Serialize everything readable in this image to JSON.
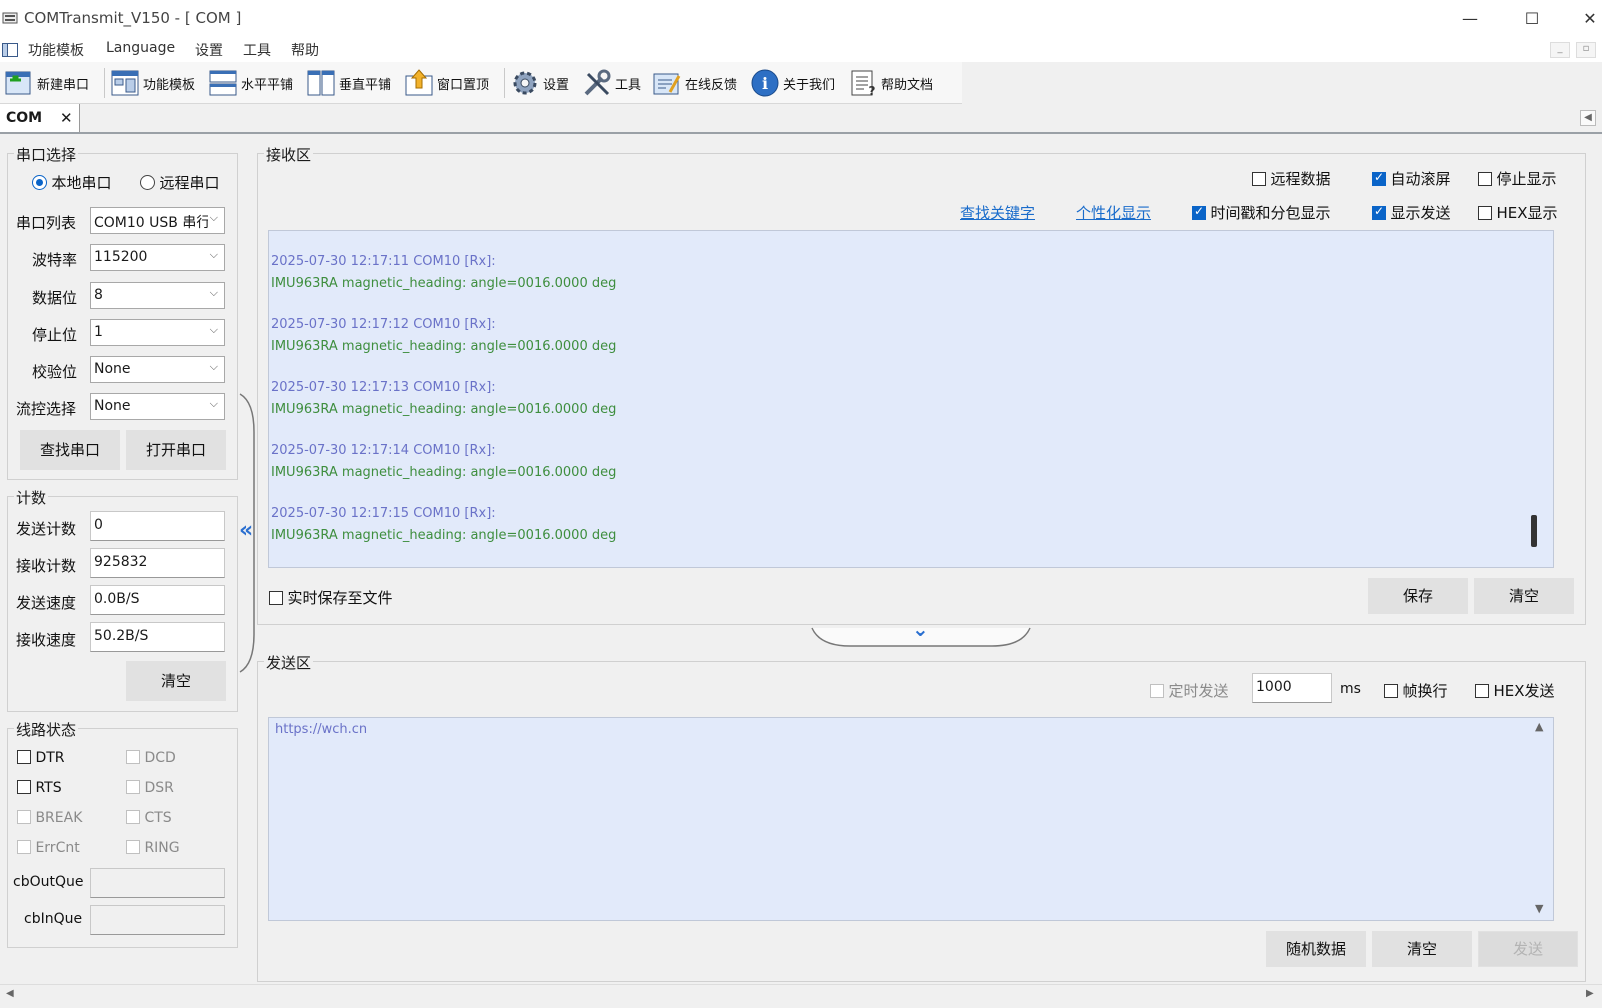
{
  "window": {
    "title": "COMTransmit_V150 - [  COM  ]"
  },
  "menu": [
    "功能模板",
    "Language",
    "设置",
    "工具",
    "帮助"
  ],
  "toolbar": [
    "新建串口",
    "功能模板",
    "水平平铺",
    "垂直平铺",
    "窗口置顶",
    "设置",
    "工具",
    "在线反馈",
    "关于我们",
    "帮助文档"
  ],
  "tab": {
    "label": "COM",
    "close": "✕"
  },
  "serial": {
    "title": "串口选择",
    "local_label": "本地串口",
    "remote_label": "远程串口",
    "port_label": "串口列表",
    "port_value": "COM10  USB 串行",
    "baud_label": "波特率",
    "baud_value": "115200",
    "data_label": "数据位",
    "data_value": "8",
    "stop_label": "停止位",
    "stop_value": "1",
    "parity_label": "校验位",
    "parity_value": "None",
    "flow_label": "流控选择",
    "flow_value": "None",
    "find_btn": "查找串口",
    "open_btn": "打开串口"
  },
  "count": {
    "title": "计数",
    "send_label": "发送计数",
    "send_value": "0",
    "recv_label": "接收计数",
    "recv_value": "925832",
    "send_speed_label": "发送速度",
    "send_speed_value": "0.0B/S",
    "recv_speed_label": "接收速度",
    "recv_speed_value": "50.2B/S",
    "clear_btn": "清空"
  },
  "line": {
    "title": "线路状态",
    "items": [
      "DTR",
      "DCD",
      "RTS",
      "DSR",
      "BREAK",
      "CTS",
      "ErrCnt",
      "RING"
    ],
    "out_label": "cbOutQue",
    "in_label": "cbInQue"
  },
  "collapse_glyph": "«",
  "expand_glyph": "⌄",
  "recv": {
    "title": "接收区",
    "remote_data": "远程数据",
    "auto_scroll": "自动滚屏",
    "stop_display": "停止显示",
    "find_keyword": "查找关键字",
    "custom_display": "个性化显示",
    "timestamp": "时间戳和分包显示",
    "show_send": "显示发送",
    "hex_display": "HEX显示",
    "save_to_file": "实时保存至文件",
    "save_btn": "保存",
    "clear_btn": "清空",
    "logs": [
      {
        "ts": "2025-07-30 12:17:11 COM10 [Rx]:",
        "msg": "IMU963RA magnetic_heading: angle=0016.0000 deg"
      },
      {
        "ts": "2025-07-30 12:17:12 COM10 [Rx]:",
        "msg": "IMU963RA magnetic_heading: angle=0016.0000 deg"
      },
      {
        "ts": "2025-07-30 12:17:13 COM10 [Rx]:",
        "msg": "IMU963RA magnetic_heading: angle=0016.0000 deg"
      },
      {
        "ts": "2025-07-30 12:17:14 COM10 [Rx]:",
        "msg": "IMU963RA magnetic_heading: angle=0016.0000 deg"
      },
      {
        "ts": "2025-07-30 12:17:15 COM10 [Rx]:",
        "msg": "IMU963RA magnetic_heading: angle=0016.0000 deg"
      }
    ]
  },
  "send": {
    "title": "发送区",
    "timed_send": "定时发送",
    "interval_value": "1000",
    "interval_unit": "ms",
    "frame_newline": "帧换行",
    "hex_send": "HEX发送",
    "content": "https://wch.cn",
    "random_btn": "随机数据",
    "clear_btn": "清空",
    "send_btn": "发送"
  }
}
